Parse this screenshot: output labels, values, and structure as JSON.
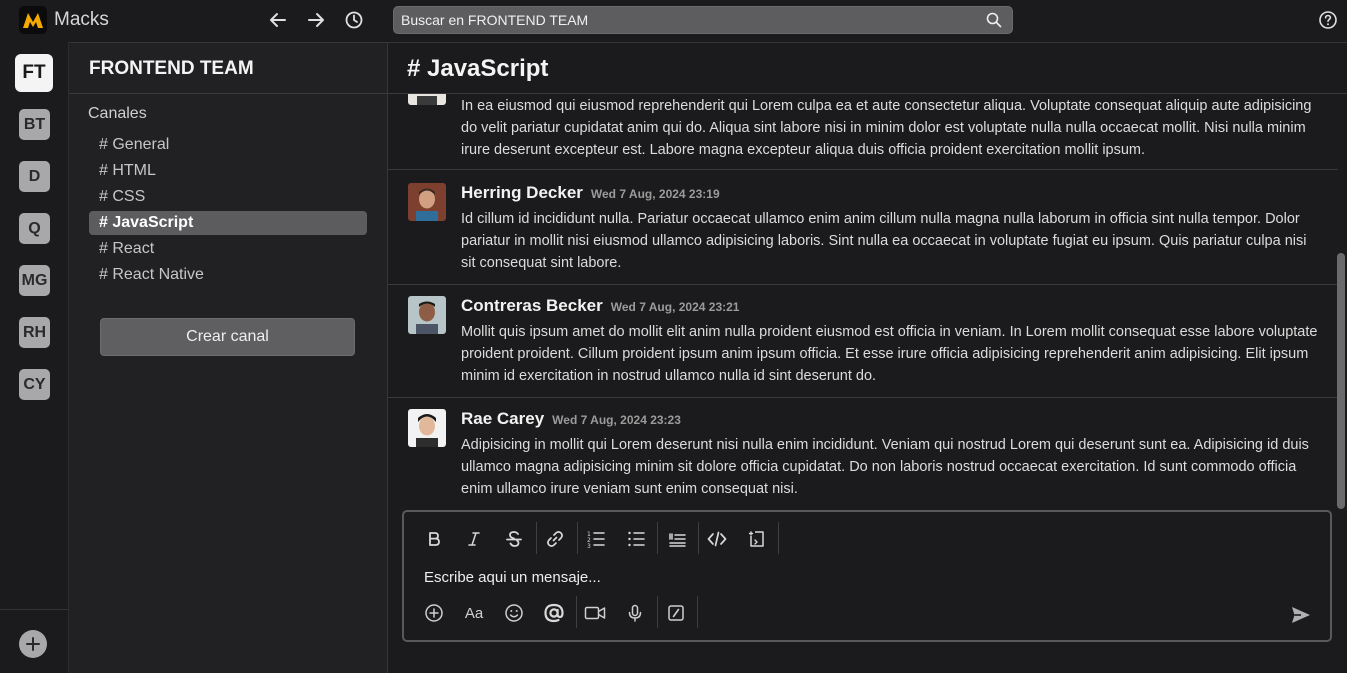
{
  "app": {
    "name": "Macks",
    "accent": "#f5a800"
  },
  "search": {
    "placeholder": "Buscar en FRONTEND TEAM"
  },
  "workspaces": [
    {
      "initials": "FT",
      "active": true
    },
    {
      "initials": "BT"
    },
    {
      "initials": "D"
    },
    {
      "initials": "Q"
    },
    {
      "initials": "MG"
    },
    {
      "initials": "RH"
    },
    {
      "initials": "CY"
    }
  ],
  "sidebar": {
    "team_name": "FRONTEND TEAM",
    "channels_label": "Canales",
    "channels": [
      {
        "label": "# General"
      },
      {
        "label": "# HTML"
      },
      {
        "label": "# CSS"
      },
      {
        "label": "# JavaScript",
        "active": true
      },
      {
        "label": "# React"
      },
      {
        "label": "# React Native"
      }
    ],
    "create_label": "Crear canal"
  },
  "channel": {
    "title": "# JavaScript"
  },
  "messages": [
    {
      "author": "",
      "time": "",
      "text": "In ea eiusmod qui eiusmod reprehenderit qui Lorem culpa ea et aute consectetur aliqua. Voluptate consequat aliquip aute adipisicing do velit pariatur cupidatat anim qui do. Aliqua sint labore nisi in minim dolor est voluptate nulla nulla occaecat mollit. Nisi nulla minim irure deserunt excepteur est. Labore magna excepteur aliqua duis officia proident exercitation mollit ipsum."
    },
    {
      "author": "Herring Decker",
      "time": "Wed 7 Aug, 2024 23:19",
      "text": "Id cillum id incididunt nulla. Pariatur occaecat ullamco enim anim cillum nulla magna nulla laborum in officia sint nulla tempor. Dolor pariatur in mollit nisi eiusmod ullamco adipisicing laboris. Sint nulla ea occaecat in voluptate fugiat eu ipsum. Quis pariatur culpa nisi sit consequat sint labore."
    },
    {
      "author": "Contreras Becker",
      "time": "Wed 7 Aug, 2024 23:21",
      "text": "Mollit quis ipsum amet do mollit elit anim nulla proident eiusmod est officia in veniam. In Lorem mollit consequat esse labore voluptate proident proident. Cillum proident ipsum anim ipsum officia. Et esse irure officia adipisicing reprehenderit anim adipisicing. Elit ipsum minim id exercitation in nostrud ullamco nulla id sint deserunt do."
    },
    {
      "author": "Rae Carey",
      "time": "Wed 7 Aug, 2024 23:23",
      "text": "Adipisicing in mollit qui Lorem deserunt nisi nulla enim incididunt. Veniam qui nostrud Lorem qui deserunt sunt ea. Adipisicing id duis ullamco magna adipisicing minim sit dolore officia cupidatat. Do non laboris nostrud occaecat exercitation. Id sunt commodo officia enim ullamco irure veniam sunt enim consequat nisi."
    }
  ],
  "composer": {
    "placeholder": "Escribe aqui un mensaje...",
    "format_text_label": "Aa"
  },
  "icons": {
    "top": [
      "back-arrow-icon",
      "forward-arrow-icon",
      "history-icon",
      "search-icon",
      "help-icon"
    ],
    "format": [
      "bold-icon",
      "italic-icon",
      "strikethrough-icon",
      "link-icon",
      "ordered-list-icon",
      "bullet-list-icon",
      "blockquote-icon",
      "code-icon",
      "code-block-icon"
    ],
    "actions": [
      "add-icon",
      "text-format-icon",
      "emoji-icon",
      "mention-icon",
      "video-icon",
      "microphone-icon",
      "slash-command-icon",
      "send-icon"
    ]
  }
}
